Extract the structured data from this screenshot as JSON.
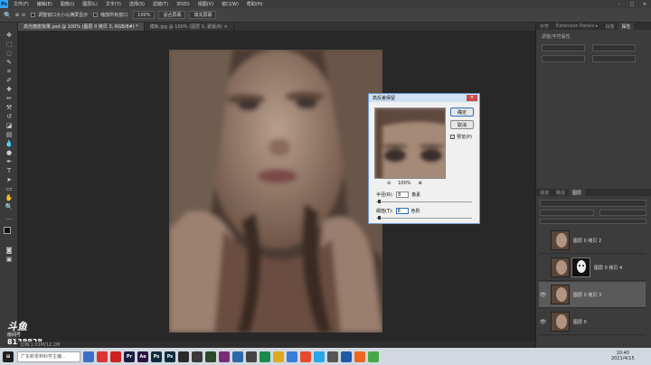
{
  "menubar": {
    "logo": "Ps",
    "items": [
      "文件(F)",
      "编辑(E)",
      "图像(I)",
      "图层(L)",
      "文字(Y)",
      "选择(S)",
      "滤镜(T)",
      "3D(D)",
      "视图(V)",
      "窗口(W)",
      "帮助(H)"
    ]
  },
  "options": {
    "resize_windows": "调整窗口大小以满屏显示",
    "zoom_all": "缩放所有窗口",
    "zoom_value": "100%",
    "fit_screen": "适合屏幕",
    "fill_screen": "填充屏幕"
  },
  "tabs": [
    {
      "label": "高光磨皮效果.psd @ 100% (图层 0 拷贝 3, RGB/8#) *",
      "active": true
    },
    {
      "label": "模板.jpg @ 100% (图层 0, 蒙版/8) ×",
      "active": false
    }
  ],
  "status": "文档:1.01M/12.2M",
  "panels": {
    "top_tabs": [
      "字符",
      "Extension Panels ▸",
      "段落",
      "属性"
    ],
    "mid_label": "调整/字符属性",
    "layer_tabs": [
      "图层",
      "通道",
      "路径"
    ]
  },
  "layers": [
    {
      "name": "图层 0 拷贝 2",
      "has_mask": false,
      "visible": false,
      "selected": false
    },
    {
      "name": "图层 0 拷贝 4",
      "has_mask": true,
      "visible": false,
      "selected": false
    },
    {
      "name": "图层 0 拷贝 3",
      "has_mask": false,
      "visible": true,
      "selected": true
    },
    {
      "name": "图层 0",
      "has_mask": false,
      "visible": true,
      "selected": false
    }
  ],
  "dialog": {
    "title": "高反差保留",
    "close": "✕",
    "ok": "确定",
    "cancel": "取消",
    "preview_label": "预览(P)",
    "zoom": "100%",
    "radius_label": "半径(R):",
    "radius_value": "8",
    "radius_unit": "像素",
    "threshold_label": "阈值(T):",
    "threshold_value": "8",
    "threshold_unit": "色阶"
  },
  "watermark": {
    "brand": "斗鱼",
    "sub": "房间号",
    "room": "8138828"
  },
  "taskbar": {
    "search_placeholder": "广东新零到科学主编...",
    "time": "10:40",
    "date": "2021/4/15"
  }
}
